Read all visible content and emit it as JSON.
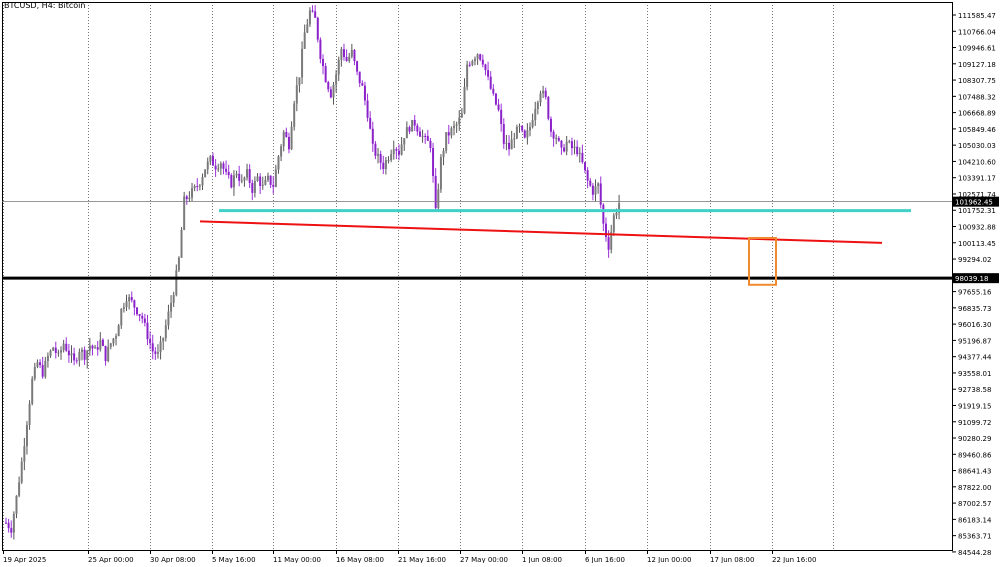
{
  "header": {
    "title": "BTCUSD, H4:  Bitcoin"
  },
  "chart_data": {
    "type": "candlestick",
    "symbol": "BTCUSD",
    "timeframe": "H4",
    "ylim": [
      84000,
      112400
    ],
    "y_ticks": [
      "111585.47",
      "110766.04",
      "109946.61",
      "109127.18",
      "108307.75",
      "107488.32",
      "106668.89",
      "105849.46",
      "105030.03",
      "104210.60",
      "103391.17",
      "102571.74",
      "101752.31",
      "100932.88",
      "100113.45",
      "99294.02",
      "98474.59",
      "97655.16",
      "96835.73",
      "96016.30",
      "95196.87",
      "94377.44",
      "93558.01",
      "92738.58",
      "91919.15",
      "91099.72",
      "90280.29",
      "89460.86",
      "88641.43",
      "87822.00",
      "87002.57",
      "86183.14",
      "85363.71",
      "84544.28"
    ],
    "x_ticks": [
      "19 Apr 2025",
      "25 Apr 00:00",
      "30 Apr 08:00",
      "5 May 16:00",
      "11 May 00:00",
      "16 May 08:00",
      "21 May 16:00",
      "27 May 00:00",
      "1 Jun 08:00",
      "6 Jun 16:00",
      "12 Jun 00:00",
      "17 Jun 08:00",
      "22 Jun 16:00"
    ],
    "price_labels": {
      "current": "101962.45",
      "support": "98039.18"
    },
    "levels": {
      "current": 101962.45,
      "support": 98039.18,
      "cyan": 101500
    },
    "trendline": {
      "start": {
        "date": "9 May 16:00",
        "price": 100950
      },
      "end": {
        "date": "25 Jun 12:00",
        "price": 99850
      }
    },
    "highlight_box": {
      "date_from": "21 Jun 12:00",
      "date_to": "22 Jun 16:00",
      "price_high": 100100,
      "price_low": 97700
    },
    "close_path": [
      [
        0,
        85500
      ],
      [
        2,
        85200
      ],
      [
        4,
        86800
      ],
      [
        6,
        88600
      ],
      [
        8,
        90700
      ],
      [
        10,
        92800
      ],
      [
        12,
        93700
      ],
      [
        14,
        93200
      ],
      [
        16,
        94000
      ],
      [
        18,
        94500
      ],
      [
        20,
        94000
      ],
      [
        22,
        94700
      ],
      [
        24,
        94200
      ],
      [
        26,
        93700
      ],
      [
        28,
        94400
      ],
      [
        30,
        94100
      ],
      [
        32,
        94600
      ],
      [
        34,
        94300
      ],
      [
        36,
        94800
      ],
      [
        38,
        94000
      ],
      [
        40,
        94700
      ],
      [
        42,
        95200
      ],
      [
        44,
        96400
      ],
      [
        46,
        97100
      ],
      [
        48,
        96800
      ],
      [
        50,
        96400
      ],
      [
        52,
        96000
      ],
      [
        54,
        95100
      ],
      [
        56,
        94300
      ],
      [
        58,
        94100
      ],
      [
        60,
        95000
      ],
      [
        62,
        96200
      ],
      [
        64,
        97400
      ],
      [
        66,
        99000
      ],
      [
        68,
        102000
      ],
      [
        70,
        102300
      ],
      [
        72,
        102600
      ],
      [
        74,
        103000
      ],
      [
        76,
        103700
      ],
      [
        78,
        104100
      ],
      [
        80,
        103800
      ],
      [
        82,
        104000
      ],
      [
        84,
        103300
      ],
      [
        86,
        102900
      ],
      [
        88,
        103500
      ],
      [
        90,
        102900
      ],
      [
        92,
        103400
      ],
      [
        94,
        102600
      ],
      [
        96,
        103200
      ],
      [
        98,
        102700
      ],
      [
        100,
        103100
      ],
      [
        102,
        102800
      ],
      [
        104,
        104300
      ],
      [
        106,
        105500
      ],
      [
        108,
        104900
      ],
      [
        110,
        107200
      ],
      [
        112,
        108500
      ],
      [
        114,
        110600
      ],
      [
        116,
        111700
      ],
      [
        118,
        111300
      ],
      [
        120,
        109500
      ],
      [
        122,
        108300
      ],
      [
        124,
        107500
      ],
      [
        126,
        108500
      ],
      [
        128,
        109800
      ],
      [
        130,
        109200
      ],
      [
        132,
        109600
      ],
      [
        134,
        108500
      ],
      [
        136,
        107800
      ],
      [
        138,
        106500
      ],
      [
        140,
        104700
      ],
      [
        142,
        104200
      ],
      [
        144,
        103800
      ],
      [
        146,
        104300
      ],
      [
        148,
        104900
      ],
      [
        150,
        104500
      ],
      [
        152,
        105400
      ],
      [
        154,
        105800
      ],
      [
        156,
        106000
      ],
      [
        158,
        105500
      ],
      [
        160,
        105100
      ],
      [
        162,
        104900
      ],
      [
        164,
        101400
      ],
      [
        166,
        104100
      ],
      [
        168,
        105300
      ],
      [
        170,
        105600
      ],
      [
        172,
        105900
      ],
      [
        174,
        106400
      ],
      [
        176,
        109000
      ],
      [
        178,
        109300
      ],
      [
        180,
        109600
      ],
      [
        182,
        109200
      ],
      [
        184,
        108200
      ],
      [
        186,
        107300
      ],
      [
        188,
        106600
      ],
      [
        190,
        105000
      ],
      [
        192,
        104700
      ],
      [
        194,
        105400
      ],
      [
        196,
        105700
      ],
      [
        198,
        105100
      ],
      [
        200,
        105800
      ],
      [
        202,
        106900
      ],
      [
        204,
        107700
      ],
      [
        206,
        107200
      ],
      [
        208,
        105600
      ],
      [
        210,
        105300
      ],
      [
        212,
        104500
      ],
      [
        214,
        105000
      ],
      [
        216,
        104700
      ],
      [
        218,
        104600
      ],
      [
        220,
        103900
      ],
      [
        222,
        103000
      ],
      [
        224,
        102500
      ],
      [
        226,
        102800
      ],
      [
        228,
        100800
      ],
      [
        230,
        99700
      ],
      [
        232,
        101200
      ],
      [
        234,
        101900
      ]
    ]
  }
}
